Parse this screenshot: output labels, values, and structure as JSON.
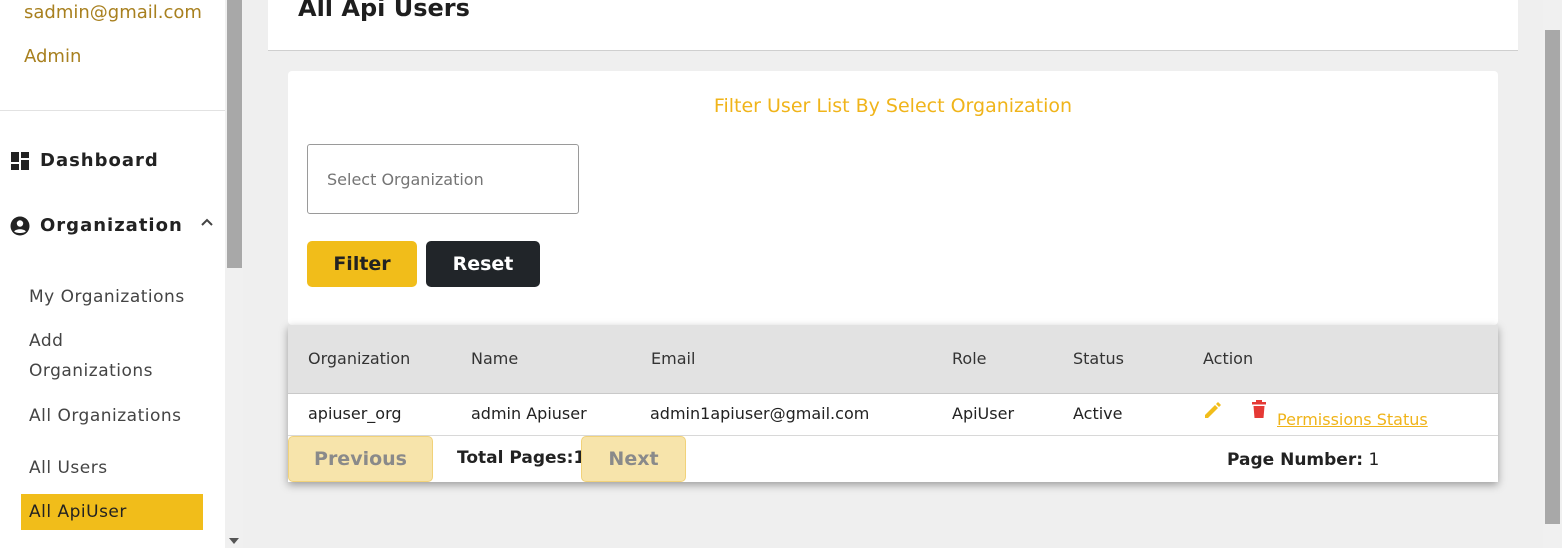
{
  "sidebar": {
    "user_email": "sadmin@gmail.com",
    "user_role": "Admin",
    "nav": {
      "dashboard": "Dashboard",
      "organization": "Organization"
    },
    "sub_items": [
      "My Organizations",
      "Add",
      "Organizations",
      "All Organizations",
      "All Users"
    ],
    "active_item": "All ApiUser"
  },
  "header": {
    "title": "All Api Users"
  },
  "filter": {
    "heading": "Filter User List By Select Organization",
    "select_placeholder": "Select Organization",
    "filter_label": "Filter",
    "reset_label": "Reset"
  },
  "table": {
    "columns": [
      "Organization",
      "Name",
      "Email",
      "Role",
      "Status",
      "Action"
    ],
    "rows": [
      {
        "organization": "apiuser_org",
        "name": "admin Apiuser",
        "email": "admin1apiuser@gmail.com",
        "role": "ApiUser",
        "status": "Active",
        "action_link": "Permissions Status"
      }
    ]
  },
  "pagination": {
    "previous_label": "Previous",
    "next_label": "Next",
    "total_pages": "Total Pages:1",
    "page_number_label": "Page Number:",
    "page_number_value": "1"
  },
  "colors": {
    "accent": "#f1bd1a",
    "heading_accent": "#f0b41a",
    "dark_button": "#212529",
    "danger": "#e53935",
    "sidebar_text": "#a8801f"
  },
  "icons": [
    "dashboard-icon",
    "account-circle-icon",
    "chevron-up-icon",
    "edit-icon",
    "delete-icon"
  ]
}
